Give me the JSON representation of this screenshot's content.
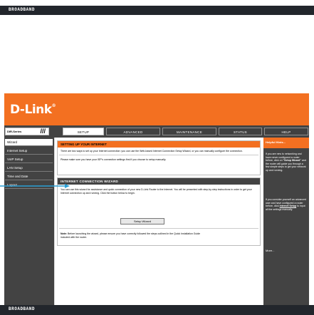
{
  "brand_bar": {
    "label": "BROADBAND"
  },
  "header": {
    "logo": "D-Link",
    "logo_mark": "®"
  },
  "nav": {
    "model": "DIR-Series",
    "tabs": [
      {
        "label": "SETUP",
        "active": true
      },
      {
        "label": "ADVANCED",
        "active": false
      },
      {
        "label": "MAINTENANCE",
        "active": false
      },
      {
        "label": "STATUS",
        "active": false
      },
      {
        "label": "HELP",
        "active": false
      }
    ]
  },
  "sidebar": {
    "items": [
      {
        "label": "Wizard",
        "active": true
      },
      {
        "label": "Internet Setup",
        "active": false
      },
      {
        "label": "VoIP Setup",
        "active": false
      },
      {
        "label": "LAN Setup",
        "active": false
      },
      {
        "label": "Time and Date",
        "active": false
      },
      {
        "label": "Logout",
        "active": false
      }
    ]
  },
  "main": {
    "setup_section": {
      "title": "SETTING UP YOUR INTERNET",
      "p1": "There are two ways to set up your Internet connection: you can use the Web-based Internet Connection Setup Wizard, or you can manually configure the connection.",
      "p2": "Please make sure you have your ISP's connection settings first if you choose to setup manually."
    },
    "wizard_section": {
      "title": "INTERNET CONNECTION WIZARD",
      "p1": "You can use this wizard for assistance and quick connection of your new D-Link Router to the Internet. You will be presented with step-by-step instructions in order to get your Internet connection up and running. Click the button below to begin.",
      "button": "Setup Wizard",
      "note_label": "Note:",
      "note": "Before launching the wizard, please ensure you have correctly followed the steps outlined in the Quick Installation Guide included with the router."
    }
  },
  "help": {
    "title": "Helpful Hints...",
    "p1_a": "If you are new to networking and have never configured a router before, click on ",
    "p1_b": "\"Setup Wizard\"",
    "p1_c": " and the router will guide you through a few simple steps to get your network up and running.",
    "p2_a": "If you consider yourself an advanced user and have configured a router before, click ",
    "p2_b": "Internet Setup",
    "p2_c": " to input all the settings manually.",
    "more": "More..."
  },
  "colors": {
    "accent": "#f37021",
    "dark": "#434343",
    "bar": "#22262c",
    "arrow": "#2a9fd6"
  }
}
